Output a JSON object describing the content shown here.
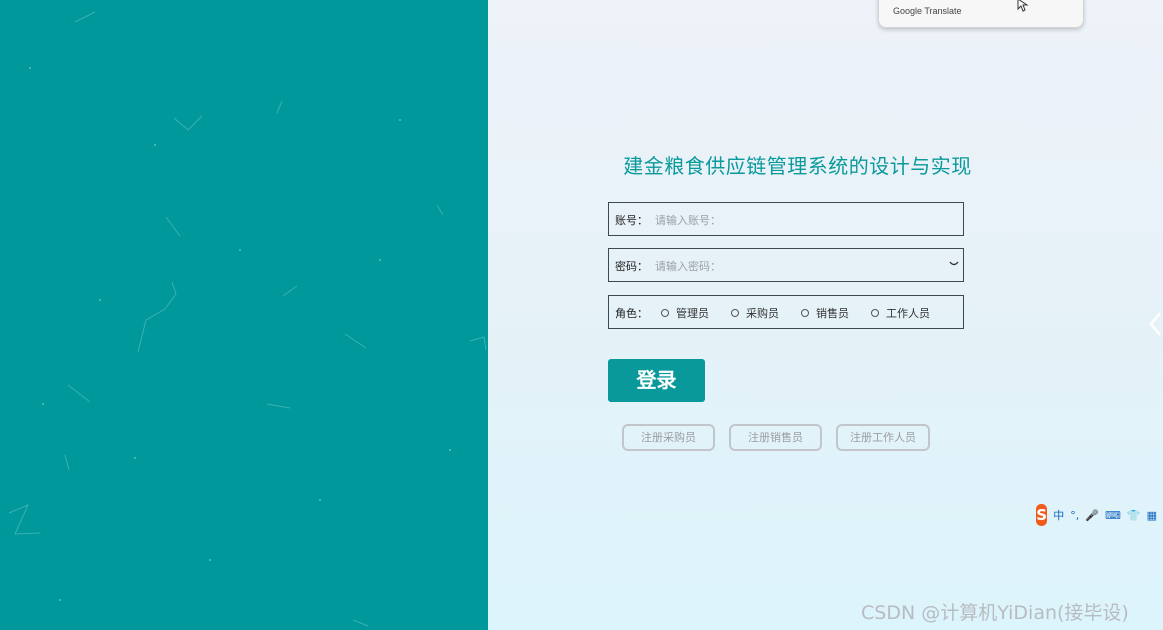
{
  "popup": {
    "label": "Google Translate"
  },
  "login": {
    "title": "建金粮食供应链管理系统的设计与实现",
    "account_label": "账号：",
    "account_placeholder": "请输入账号：",
    "password_label": "密码：",
    "password_placeholder": "请输入密码：",
    "role_label": "角色：",
    "roles": [
      "管理员",
      "采购员",
      "销售员",
      "工作人员"
    ],
    "submit_label": "登录"
  },
  "register": {
    "buttons": [
      "注册采购员",
      "注册销售员",
      "注册工作人员"
    ]
  },
  "ime": {
    "mode": "中",
    "punct": "°,",
    "mic": "🎤",
    "keyboard": "⌨",
    "skin": "👕",
    "grid": "▦"
  },
  "watermark": "CSDN @计算机YiDian(接毕设)",
  "colors": {
    "accent": "#00989a",
    "button": "#0a999b",
    "title": "#0a9a9c"
  }
}
